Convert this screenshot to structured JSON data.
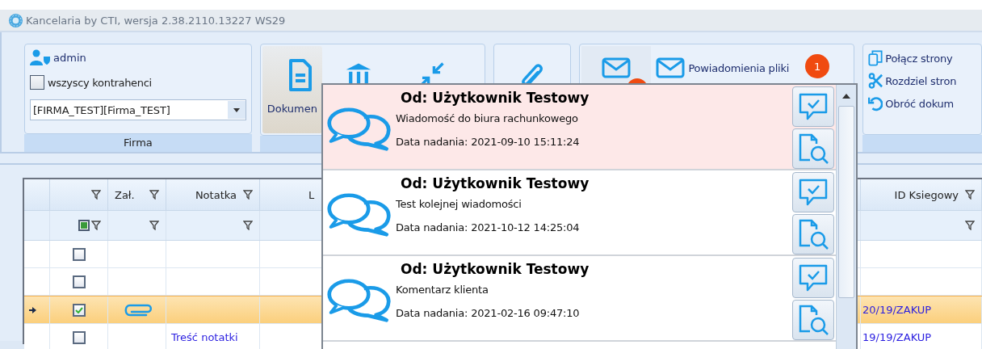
{
  "window": {
    "title": "Kancelaria by CTI, wersja  2.38.2110.13227 WS29"
  },
  "ribbon": {
    "firma_group": {
      "user": "admin",
      "all_contractors": {
        "label": "wszyscy kontrahenci",
        "checked": false
      },
      "company_select": {
        "value": "[FIRMA_TEST][Firma_TEST]"
      },
      "caption": "Firma"
    },
    "documents_group": {
      "buttons": [
        {
          "kind": "document",
          "label": "Dokumen"
        },
        {
          "kind": "bank"
        },
        {
          "kind": "merge"
        }
      ]
    },
    "attachments_group": {
      "buttons": [
        {
          "kind": "paperclip"
        }
      ]
    },
    "notifications_group": {
      "buttons": [
        {
          "kind": "envelope",
          "badge_dot": true
        },
        {
          "kind": "envelope_wide",
          "label": "Powiadomienia pliki",
          "badge": "1"
        }
      ]
    },
    "pages_group": {
      "items": [
        {
          "kind": "copy",
          "label": "Połącz strony"
        },
        {
          "kind": "scissors",
          "label": "Rozdziel stron"
        },
        {
          "kind": "rotate",
          "label": "Obróć dokum"
        }
      ]
    }
  },
  "grid": {
    "columns": [
      {
        "kind": "indicator"
      },
      {
        "kind": "check"
      },
      {
        "kind": "text",
        "label": "Zał."
      },
      {
        "kind": "text",
        "label": "Notatka"
      },
      {
        "kind": "text",
        "label": "L"
      },
      {
        "kind": "text",
        "label": "ID Ksiegowy"
      }
    ],
    "select_all_indeterminate": true,
    "rows": [
      {
        "current": false,
        "checked": false,
        "attachment": false
      },
      {
        "current": false,
        "checked": false,
        "attachment": false
      },
      {
        "current": true,
        "checked": true,
        "attachment": true,
        "id": "20/19/ZAKUP"
      },
      {
        "current": false,
        "checked": false,
        "attachment": false,
        "note": "Treść notatki",
        "id": "19/19/ZAKUP"
      }
    ]
  },
  "notifications_popup": {
    "messages": [
      {
        "unread": true,
        "sender": "Od: Użytkownik Testowy",
        "text": "Wiadomość do biura rachunkowego",
        "date": "Data nadania: 2021-09-10 15:11:24"
      },
      {
        "unread": false,
        "sender": "Od: Użytkownik Testowy",
        "text": "Test kolejnej wiadomości",
        "date": "Data nadania: 2021-10-12 14:25:04"
      },
      {
        "unread": false,
        "sender": "Od: Użytkownik Testowy",
        "text": "Komentarz klienta",
        "date": "Data nadania: 2021-02-16 09:47:10"
      }
    ]
  }
}
